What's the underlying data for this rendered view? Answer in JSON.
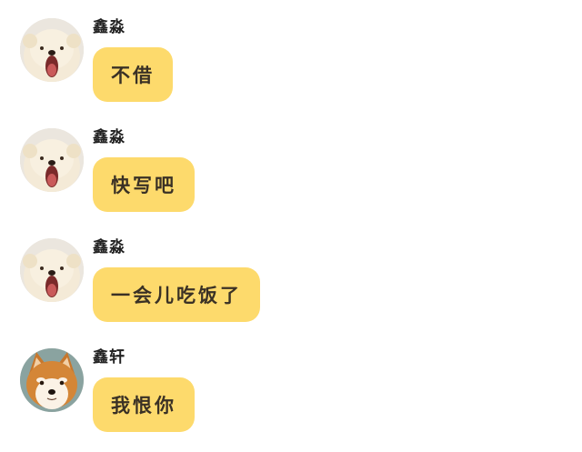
{
  "messages": [
    {
      "sender": "鑫淼",
      "text": "不借",
      "avatar": "fluffy-puppy-avatar"
    },
    {
      "sender": "鑫淼",
      "text": "快写吧",
      "avatar": "fluffy-puppy-avatar"
    },
    {
      "sender": "鑫淼",
      "text": "一会儿吃饭了",
      "avatar": "fluffy-puppy-avatar"
    },
    {
      "sender": "鑫轩",
      "text": "我恨你",
      "avatar": "shiba-inu-avatar"
    }
  ],
  "colors": {
    "bubble": "#fdda6c",
    "bubble_text": "#3a3125",
    "sender": "#222222",
    "background": "#ffffff"
  }
}
